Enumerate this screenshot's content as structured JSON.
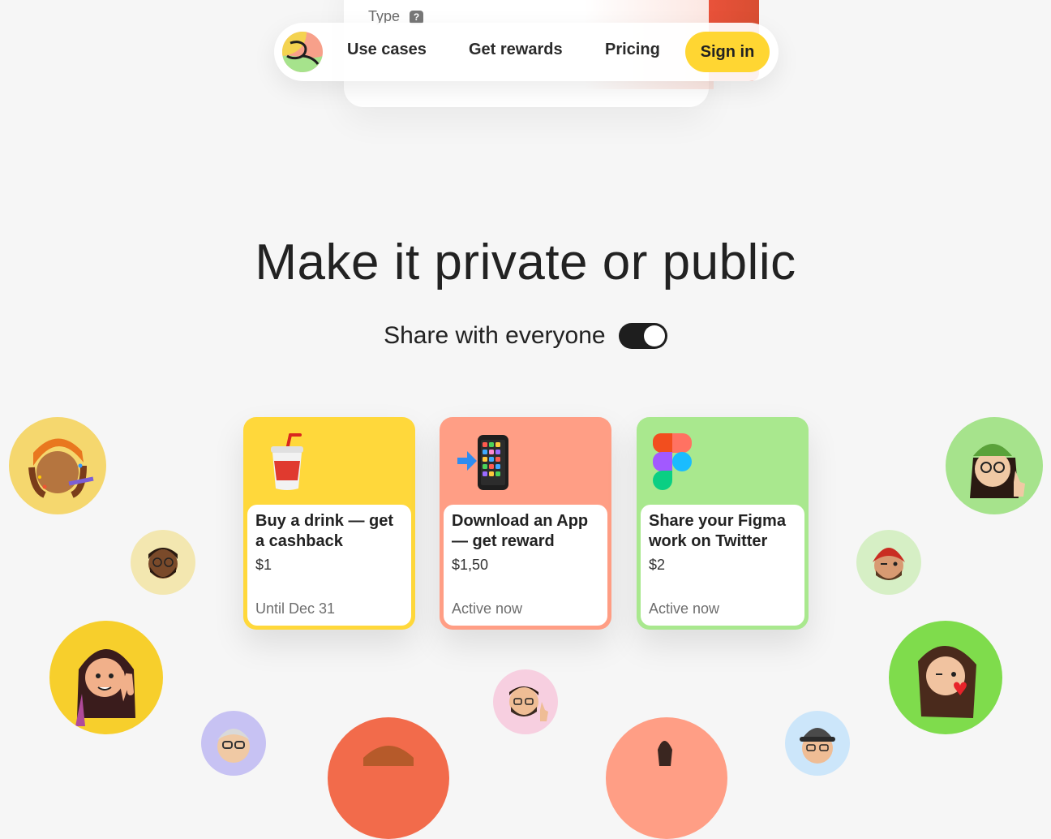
{
  "colors": {
    "background": "#f6f6f6",
    "accent_yellow": "#ffd632",
    "card_yellow": "#ffd83b",
    "card_salmon": "#ff9e85",
    "card_green": "#a9e88e"
  },
  "preview": {
    "type_label": "Type",
    "help_icon": "?"
  },
  "nav": {
    "logo": "logo-icon",
    "links": [
      "Use cases",
      "Get rewards",
      "Pricing"
    ],
    "sign_in": "Sign in"
  },
  "hero": {
    "title": "Make it private or public",
    "share_label": "Share with everyone",
    "share_toggle_on": true
  },
  "cards": [
    {
      "icon": "cup-with-straw-icon",
      "title": "Buy a drink — get a cashback",
      "price": "$1",
      "status": "Until Dec 31",
      "color": "#ffd83b"
    },
    {
      "icon": "phone-download-icon",
      "title": "Download an App — get reward",
      "price": "$1,50",
      "status": "Active now",
      "color": "#ff9e85"
    },
    {
      "icon": "figma-icon",
      "title": "Share your Figma work on Twitter",
      "price": "$2",
      "status": "Active now",
      "color": "#a9e88e"
    }
  ],
  "avatars": [
    {
      "name": "avatar-party",
      "bg": "#f5d76e"
    },
    {
      "name": "avatar-glasses-man",
      "bg": "#f3e7b0"
    },
    {
      "name": "avatar-peace-woman",
      "bg": "#f7cf2c"
    },
    {
      "name": "avatar-gray-hair",
      "bg": "#c7c2f3"
    },
    {
      "name": "avatar-bottom-red",
      "bg": "#f26b4b"
    },
    {
      "name": "avatar-thumbs-man",
      "bg": "#f7cfe0"
    },
    {
      "name": "avatar-bottom-salmon",
      "bg": "#ff9e85"
    },
    {
      "name": "avatar-cap-man",
      "bg": "#cce6fa"
    },
    {
      "name": "avatar-green-hat",
      "bg": "#a6e38c"
    },
    {
      "name": "avatar-turban-wink",
      "bg": "#d6efc5"
    },
    {
      "name": "avatar-kiss-woman",
      "bg": "#7fdc4c"
    }
  ]
}
